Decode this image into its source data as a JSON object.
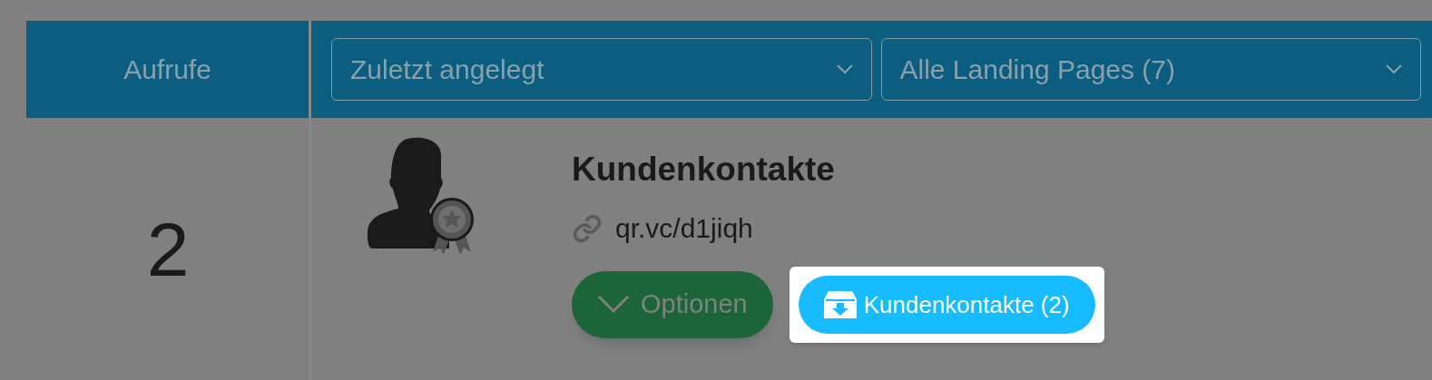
{
  "header": {
    "views_label": "Aufrufe",
    "sort_dropdown": {
      "value": "Zuletzt angelegt"
    },
    "filter_dropdown": {
      "value": "Alle Landing Pages (7)"
    }
  },
  "row": {
    "views": "2",
    "title": "Kundenkontakte",
    "link": "qr.vc/d1jiqh",
    "options_button": {
      "label": "Optionen"
    },
    "contacts_button": {
      "label": "Kundenkontakte (2)",
      "highlighted": true
    }
  }
}
